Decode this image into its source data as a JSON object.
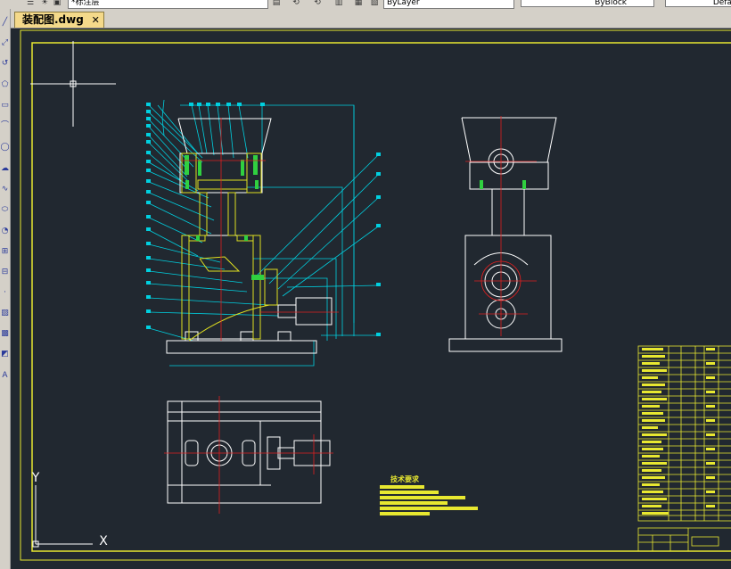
{
  "toolbar": {
    "layer_name": "*标注层",
    "color_value": "ByLayer",
    "lineweight_value": "ByBlock",
    "linetype_value": "Defa"
  },
  "tabs": [
    {
      "label": "装配图.dwg",
      "active": true
    }
  ],
  "drawing": {
    "tech_requirements_title": "技术要求"
  },
  "ucs": {
    "x_label": "X",
    "y_label": "Y"
  },
  "colors": {
    "canvas_bg": "#212830",
    "frame": "#e8e830",
    "part_lines": "#ffffff",
    "leader_lines": "#00d0e0",
    "center_lines": "#e02020",
    "hatch": "#e0e020",
    "highlight": "#30d040"
  },
  "icons": [
    "cursor-crosshair-icon",
    "ucs-icon",
    "tab-close-icon"
  ]
}
